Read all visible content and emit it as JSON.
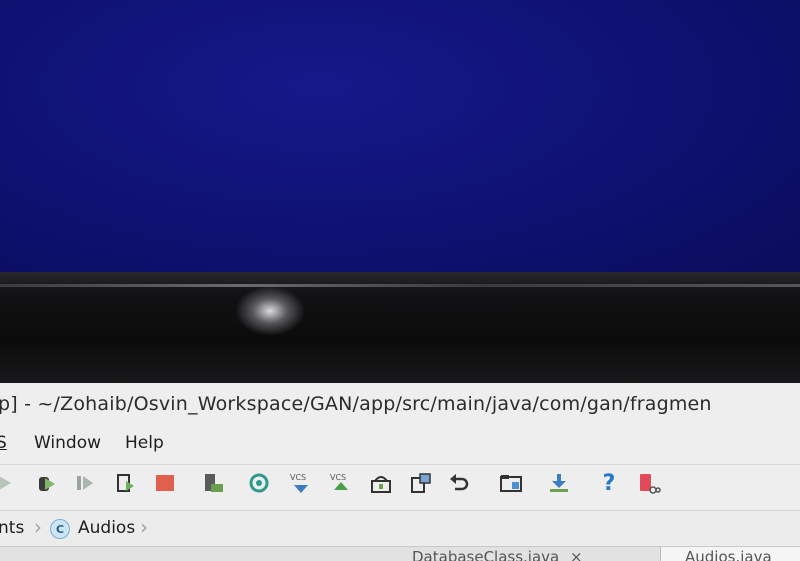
{
  "window": {
    "title": "p] - ~/Zohaib/Osvin_Workspace/GAN/app/src/main/java/com/gan/fragmen"
  },
  "menu": {
    "items": [
      {
        "label": "S"
      },
      {
        "label": "Window"
      },
      {
        "label": "Help"
      }
    ]
  },
  "toolbar": {
    "icons": [
      "run-icon",
      "debug-icon",
      "coverage-icon",
      "apply-changes-icon",
      "stop-icon",
      "avd-manager-icon",
      "sync-icon",
      "vcs-update-icon",
      "vcs-commit-icon",
      "sdk-manager-icon",
      "structure-icon",
      "undo-icon",
      "device-file-icon",
      "download-icon",
      "help-icon",
      "android-device-icon"
    ],
    "vcs_label": "VCS",
    "help_glyph": "?"
  },
  "breadcrumb": {
    "items": [
      "nts",
      "Audios"
    ],
    "class_glyph": "C"
  },
  "editor_tabs": {
    "items": [
      "DatabaseClass.java",
      "Audios.java"
    ],
    "close_glyph": "×"
  }
}
